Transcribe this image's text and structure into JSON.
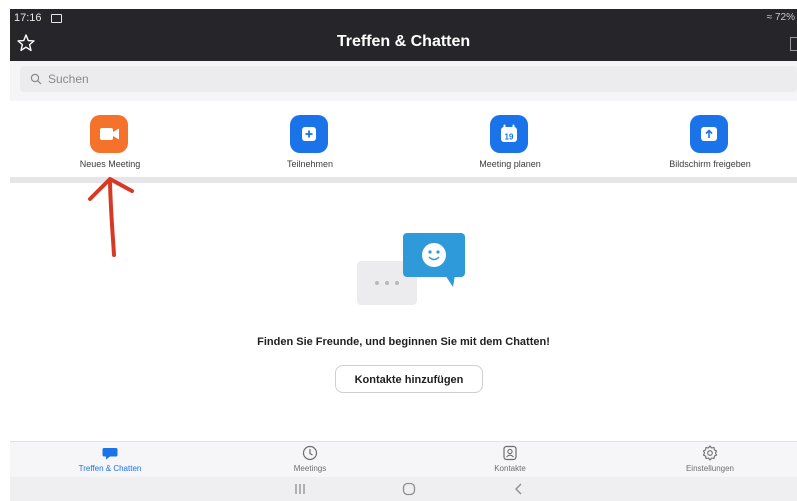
{
  "status_bar": {
    "time": "17:16",
    "battery": "≈ 72%"
  },
  "header": {
    "title": "Treffen & Chatten"
  },
  "search": {
    "placeholder": "Suchen"
  },
  "actions": [
    {
      "label": "Neues Meeting",
      "icon": "video-camera-icon",
      "color": "#f5722b"
    },
    {
      "label": "Teilnehmen",
      "icon": "plus-icon",
      "color": "#1a73e8"
    },
    {
      "label": "Meeting planen",
      "icon": "calendar-icon",
      "calendar_day": "19",
      "color": "#1a73e8"
    },
    {
      "label": "Bildschirm freigeben",
      "icon": "share-screen-icon",
      "color": "#1a73e8"
    }
  ],
  "empty_state": {
    "message": "Finden Sie Freunde, und beginnen Sie mit dem Chatten!",
    "button_label": "Kontakte hinzufügen"
  },
  "tabs": [
    {
      "label": "Treffen & Chatten",
      "icon": "chat-bubble-icon",
      "active": true
    },
    {
      "label": "Meetings",
      "icon": "clock-icon",
      "active": false
    },
    {
      "label": "Kontakte",
      "icon": "contact-icon",
      "active": false
    },
    {
      "label": "Einstellungen",
      "icon": "gear-icon",
      "active": false
    }
  ],
  "colors": {
    "accent": "#1a73e8",
    "orange": "#f5722b",
    "header_bg": "#26262a"
  }
}
